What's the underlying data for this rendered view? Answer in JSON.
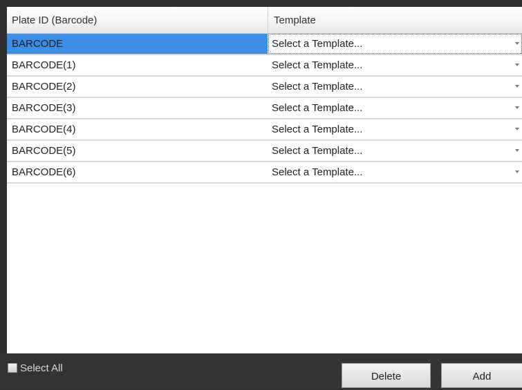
{
  "grid": {
    "columns": [
      "Plate ID (Barcode)",
      "Template"
    ],
    "rows": [
      {
        "plate_id": "BARCODE",
        "template": "Select a Template..."
      },
      {
        "plate_id": "BARCODE(1)",
        "template": "Select a Template..."
      },
      {
        "plate_id": "BARCODE(2)",
        "template": "Select a Template..."
      },
      {
        "plate_id": "BARCODE(3)",
        "template": "Select a Template..."
      },
      {
        "plate_id": "BARCODE(4)",
        "template": "Select a Template..."
      },
      {
        "plate_id": "BARCODE(5)",
        "template": "Select a Template..."
      },
      {
        "plate_id": "BARCODE(6)",
        "template": "Select a Template..."
      }
    ],
    "selected_row": 0
  },
  "footer": {
    "select_all_label": "Select All",
    "select_all_checked": false,
    "delete_label": "Delete",
    "add_label": "Add"
  },
  "colors": {
    "selection": "#3d8fe6",
    "background_dark": "#2f2f2f"
  },
  "icons": {
    "dropdown": "chevron-down-icon",
    "checkbox": "checkbox-icon"
  }
}
